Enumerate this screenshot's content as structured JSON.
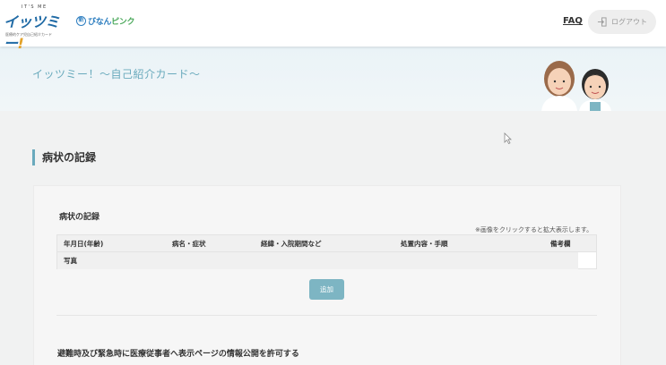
{
  "header": {
    "logo": {
      "tagline": "IT'S ME",
      "name_main": "イッツミー",
      "name_mark": "!",
      "subtitle": "医療的ケア児自己紹介カード"
    },
    "partner": {
      "badge": "新",
      "name_blue": "びなん",
      "name_green": "ピンク"
    },
    "faq_label": "FAQ",
    "logout_label": "ログアウト"
  },
  "banner": {
    "title": "イッツミー！～自己紹介カード～"
  },
  "main": {
    "section_title": "病状の記録",
    "card_title": "病状の記録",
    "note": "※画像をクリックすると拡大表示します。",
    "table": {
      "columns": [
        "年月日(年齢)",
        "病名・症状",
        "経緯・入院期間など",
        "処置内容・手順",
        "備考欄"
      ],
      "photo_label": "写真"
    },
    "add_button": "追加",
    "permit_label": "避難時及び緊急時に医療従事者へ表示ページの情報公開を許可する"
  },
  "colors": {
    "accent": "#6aaabd",
    "button": "#7db5c3",
    "logo_blue": "#1f6aa5",
    "logo_yellow": "#e3a22a"
  },
  "icons": {
    "logout": "logout-icon",
    "cursor": "mouse-cursor-icon"
  }
}
